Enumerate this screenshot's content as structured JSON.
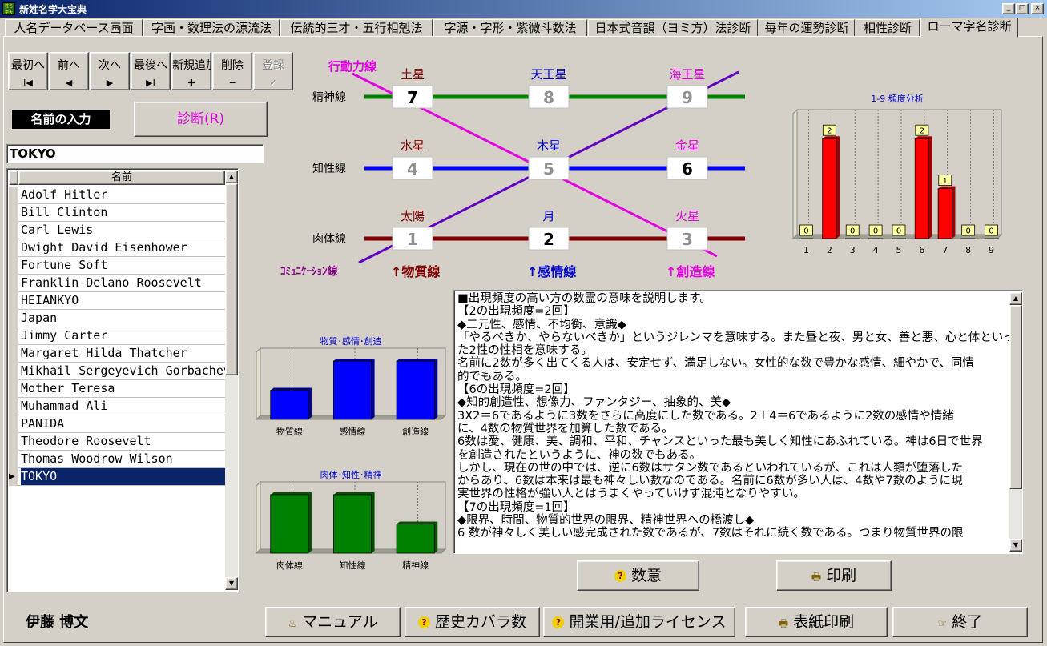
{
  "window": {
    "title": "新姓名学大宝典",
    "icon_label": "姓名学大",
    "controls": [
      "_",
      "□",
      "×"
    ]
  },
  "tabs": [
    "人名データベース画面",
    "字画・数理法の源流法",
    "伝統的三才・五行相剋法",
    "字源・字形・紫微斗数法",
    "日本式音韻（ヨミ方）法診断",
    "毎年の運勢診断",
    "相性診断",
    "ローマ字名診断"
  ],
  "active_tab": 7,
  "nav_buttons": [
    {
      "label": "最初へ",
      "glyph": "I◀"
    },
    {
      "label": "前へ",
      "glyph": "◀"
    },
    {
      "label": "次へ",
      "glyph": "▶"
    },
    {
      "label": "最後へ",
      "glyph": "▶I"
    },
    {
      "label": "新規追加",
      "glyph": "✚"
    },
    {
      "label": "削除",
      "glyph": "━"
    },
    {
      "label": "登録",
      "glyph": "✓",
      "disabled": true
    }
  ],
  "name_input_label": "名前の入力",
  "diagnose_button": "診断(R)",
  "name_input_value": "TOKYO",
  "list": {
    "header": "名前",
    "selected_index": 16,
    "items": [
      "Adolf Hitler",
      "Bill Clinton",
      "Carl Lewis",
      "Dwight David Eisenhower",
      "Fortune Soft",
      "Franklin Delano Roosevelt",
      "HEIANKYO",
      "Japan",
      "Jimmy Carter",
      "Margaret Hilda Thatcher",
      "Mikhail Sergeyevich Gorbachev",
      "Mother Teresa",
      "Muhammad Ali",
      "PANIDA",
      "Theodore Roosevelt",
      "Thomas Woodrow Wilson",
      "TOKYO"
    ]
  },
  "author": "伊藤 博文",
  "grid": {
    "row_labels": [
      "精神線",
      "知性線",
      "肉体線"
    ],
    "cells": [
      {
        "planet": "土星",
        "number": "7",
        "lit": true,
        "color": "#800000"
      },
      {
        "planet": "天王星",
        "number": "8",
        "lit": false,
        "color": "#0000cc"
      },
      {
        "planet": "海王星",
        "number": "9",
        "lit": false,
        "color": "#e000e0"
      },
      {
        "planet": "水星",
        "number": "4",
        "lit": false,
        "color": "#800000"
      },
      {
        "planet": "木星",
        "number": "5",
        "lit": false,
        "color": "#0000cc"
      },
      {
        "planet": "金星",
        "number": "6",
        "lit": true,
        "color": "#e000e0"
      },
      {
        "planet": "太陽",
        "number": "1",
        "lit": false,
        "color": "#800000"
      },
      {
        "planet": "月",
        "number": "2",
        "lit": true,
        "color": "#0000cc"
      },
      {
        "planet": "火星",
        "number": "3",
        "lit": false,
        "color": "#e000e0"
      }
    ],
    "action_line_label": "行動力線",
    "communication_line_label": "ｺﾐｭﾆｹｰｼｮﾝ線",
    "column_labels": [
      {
        "text": "↑物質線",
        "color": "#800000"
      },
      {
        "text": "↑感情線",
        "color": "#0000cc"
      },
      {
        "text": "↑創造線",
        "color": "#e000e0"
      }
    ],
    "line_colors": {
      "spirit": "#008000",
      "intellect": "#0000ff",
      "body": "#800000",
      "diagonal": "#e000e0",
      "cross": "#6000c0"
    }
  },
  "chart_data": [
    {
      "type": "bar",
      "title": "1-9 頻度分析",
      "categories": [
        "1",
        "2",
        "3",
        "4",
        "5",
        "6",
        "7",
        "8",
        "9"
      ],
      "values": [
        0,
        2,
        0,
        0,
        0,
        2,
        1,
        0,
        0
      ],
      "ylim": [
        0,
        2.5
      ],
      "bar_color": "#ff0000",
      "grid": true
    },
    {
      "type": "bar",
      "title": "物質･感情･創造",
      "categories": [
        "物質線",
        "感情線",
        "創造線"
      ],
      "values": [
        1,
        2,
        2
      ],
      "ylim": [
        0,
        2.3
      ],
      "bar_color": "#0000ff",
      "grid": true
    },
    {
      "type": "bar",
      "title": "肉体･知性･精神",
      "categories": [
        "肉体線",
        "知性線",
        "精神線"
      ],
      "values": [
        2,
        2,
        1
      ],
      "ylim": [
        0,
        2.3
      ],
      "bar_color": "#008000",
      "grid": true
    }
  ],
  "description_lines": [
    "■出現頻度の高い方の数霊の意味を説明します。",
    "【2の出現頻度=2回】",
    "◆二元性、感情、不均衡、意識◆",
    "「やるべきか、やらないべきか」というジレンマを意味する。また昼と夜、男と女、善と悪、心と体といっ",
    "た2性の性相を意味する。",
    "名前に2数が多く出てくる人は、安定せず、満足しない。女性的な数で豊かな感情、細やかで、同情",
    "的でもある。",
    "【6の出現頻度=2回】",
    "◆知的創造性、想像力、ファンタジー、抽象的、美◆",
    "3X2＝6であるように3数をさらに高度にした数である。2＋4＝6であるように2数の感情や情緒",
    "に、4数の物質世界を加算した数である。",
    "6数は愛、健康、美、調和、平和、チャンスといった最も美しく知性にあふれている。神は6日で世界",
    "を創造されたというように、神の数でもある。",
    "しかし、現在の世の中では、逆に6数はサタン数であるといわれているが、これは人類が堕落した",
    "からあり、6数は本来は最も神々しい数なのである。名前に6数が多い人は、4数や7数のように現",
    "実世界の性格が強い人とはうまくやっていけず混沌となりやすい。",
    "【7の出現頻度=1回】",
    "◆限界、時間、物質的世界の限界、精神世界への橋渡し◆",
    "6 数が神々しく美しい感完成された数であるが、7数はそれに続く数である。つまり物質世界の限"
  ],
  "buttons": {
    "meaning": "数意",
    "print": "印刷",
    "manual": "マニュアル",
    "history": "歴史カバラ数",
    "license": "開業用/追加ライセンス",
    "cover_print": "表紙印刷",
    "exit": "終了"
  }
}
